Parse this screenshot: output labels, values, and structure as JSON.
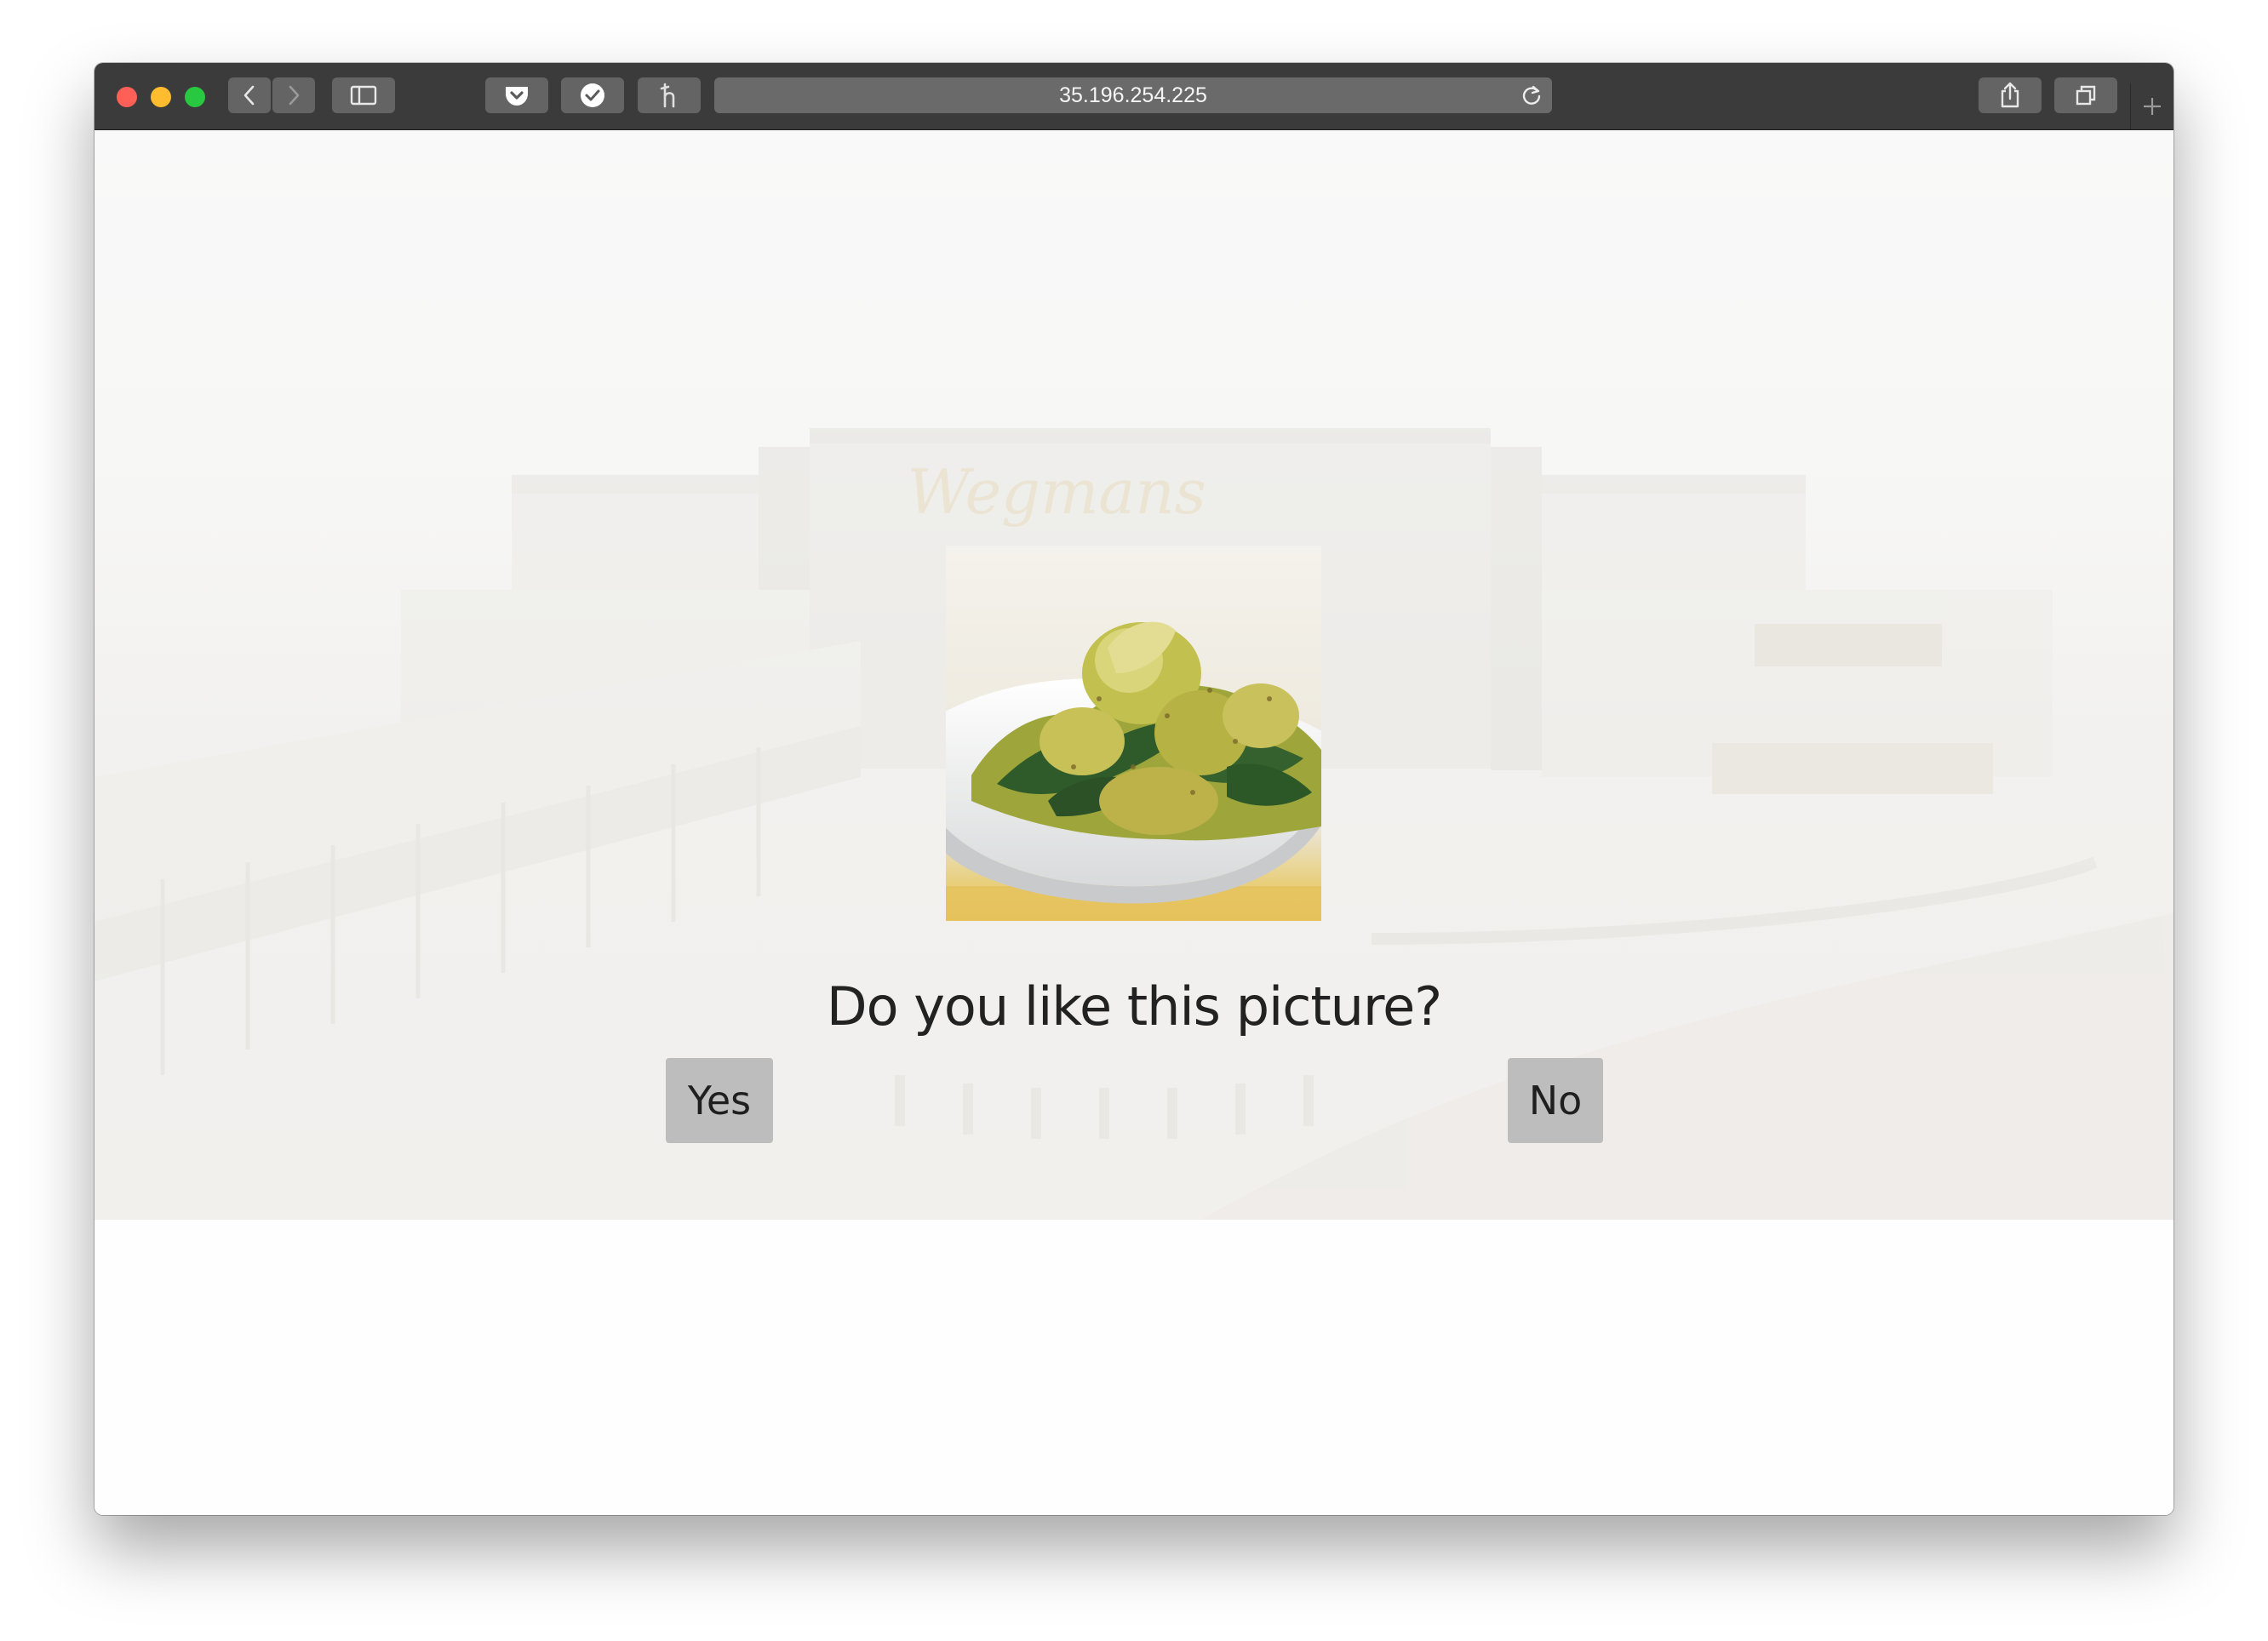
{
  "browser": {
    "url": "35.196.254.225"
  },
  "page": {
    "question": "Do you like this picture?",
    "yes_label": "Yes",
    "no_label": "No",
    "background_sign_text": "Wegmans"
  },
  "colors": {
    "toolbar": "#3b3b3b",
    "button_bg": "#bdbdbd",
    "text": "#222222"
  }
}
